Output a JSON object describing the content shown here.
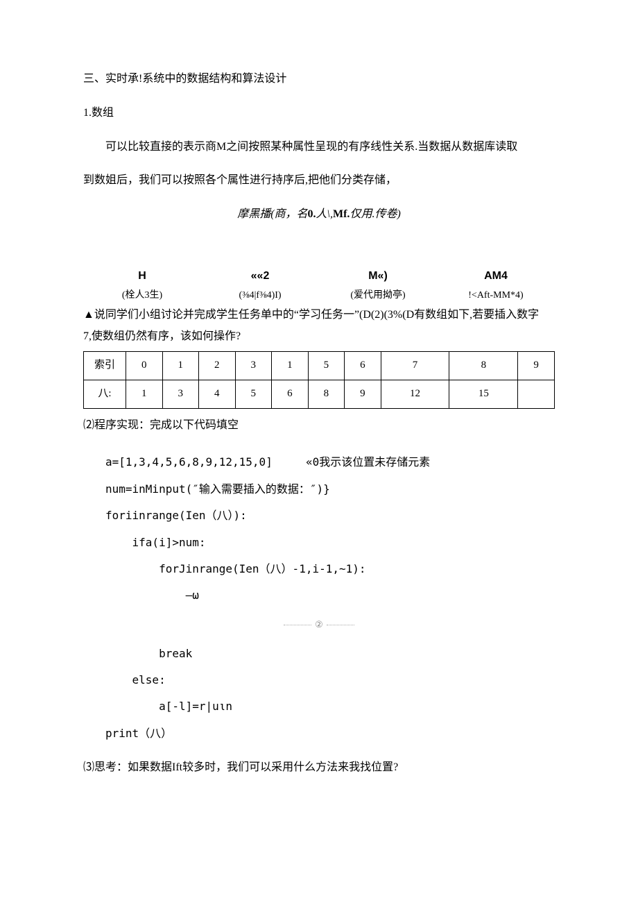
{
  "heading": "三、实时承!系统中的数据结构和算法设计",
  "subheading": "1.数组",
  "para1": "可以比较直接的表示商M之间按照某种属性呈现的有序线性关系.当数据从数据库读取",
  "para1b": "到数姐后，我们可以按照各个属性进行持序后,把他们分类存储，",
  "centered_italic_pre": "摩黑播(商，名",
  "centered_italic_bold": "0.",
  "centered_italic_mid": "人\\,",
  "centered_italic_bold2": "Mf.",
  "centered_italic_post": "仅用.传卷)",
  "row4": [
    {
      "top": "H",
      "bottom": "(栓人3生)"
    },
    {
      "top": "««2",
      "bottom": "(⅜4|f⅜4)I)"
    },
    {
      "top": "M«)",
      "bottom": "(爱代用拗亭)"
    },
    {
      "top": "AM4",
      "bottom": "!<Aft-MM*4)"
    }
  ],
  "task_pre": "▲说同学们小组讨论并完成学生任务单中的“学习任务一”(D(2)(3%(D有数组如下,若要插入数字",
  "task_line2": "7,使数组仍然有序，该如何操作?",
  "table": {
    "row1_label": "索引",
    "row1": [
      "0",
      "1",
      "2",
      "3",
      "1",
      "5",
      "6",
      "7",
      "8",
      "9"
    ],
    "row2_label": "八:",
    "row2": [
      "1",
      "3",
      "4",
      "5",
      "6",
      "8",
      "9",
      "12",
      "15",
      ""
    ]
  },
  "section2": "⑵程序实现：完成以下代码填空",
  "code": {
    "l1_a": "a=[1,3,4,5,6,8,9,12,15,0]",
    "l1_b": "«0我示该位置未存储元素",
    "l2": "num=inMinput(″输入需要插入的数据：″)}",
    "l3": "foriinrange(Ien（八）):",
    "l4": "ifa(i]>num:",
    "l5": "forJinrange(Ien（八）-1,i-1,~1):",
    "l6": "—ω",
    "blank2": "②",
    "l7": "break",
    "l8": "else:",
    "l9": "a[-l]=r∣uιn",
    "l10": "print（八）"
  },
  "section3": "⑶思考：如果数据Ift较多时，我们可以采用什么方法来我找位置?"
}
